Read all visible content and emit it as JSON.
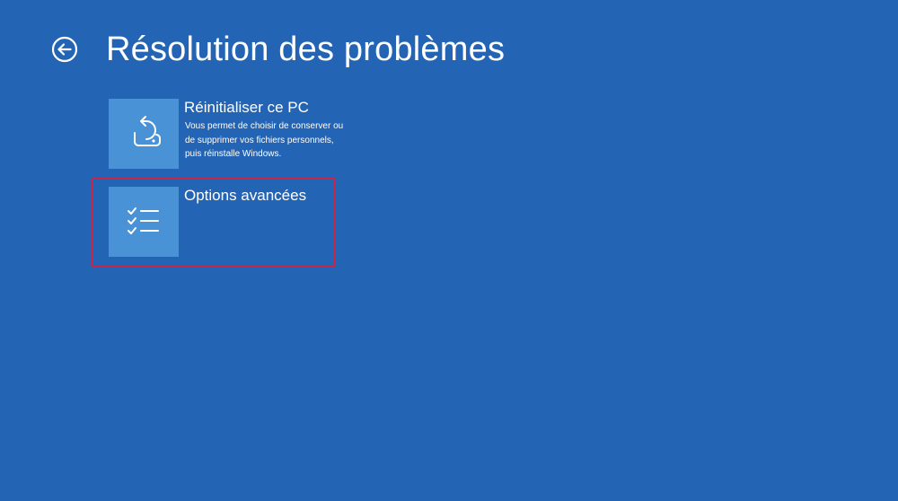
{
  "header": {
    "title": "Résolution des problèmes",
    "back_icon": "back-arrow-circle-icon"
  },
  "options": [
    {
      "title": "Réinitialiser ce PC",
      "description": "Vous permet de choisir de conserver ou de supprimer vos fichiers personnels, puis réinstalle Windows.",
      "icon": "reset-pc-icon"
    },
    {
      "title": "Options avancées",
      "description": "",
      "icon": "checklist-icon",
      "highlighted": true
    }
  ],
  "colors": {
    "background": "#2464b4",
    "tile": "#4a92d6",
    "highlight": "#c8254a",
    "text": "#ffffff"
  }
}
